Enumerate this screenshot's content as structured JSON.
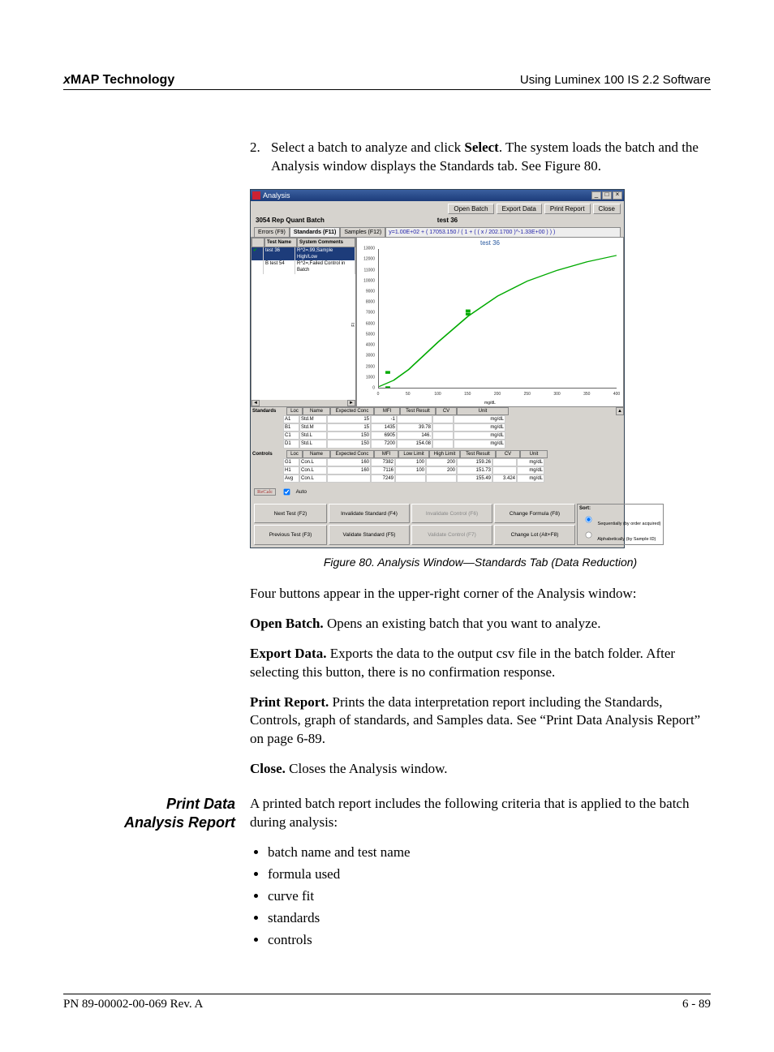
{
  "header": {
    "brand_x": "x",
    "brand_rest": "MAP Technology",
    "right": "Using Luminex 100 IS 2.2 Software"
  },
  "step2": {
    "num": "2.",
    "text_before_bold": "Select a batch to analyze and click ",
    "bold": "Select",
    "text_after": ". The system loads the batch and the Analysis window displays the Standards tab. See Figure 80."
  },
  "figure_caption": "Figure 80.  Analysis Window—Standards Tab (Data Reduction)",
  "intro_para": "Four buttons appear in the upper-right corner of the Analysis window:",
  "btns_desc": {
    "open_batch": {
      "title": "Open Batch.",
      "text": " Opens an existing batch that you want to analyze."
    },
    "export_data": {
      "title": "Export Data.",
      "text": " Exports the data to the output csv file in the batch folder. After selecting this button, there is no confirmation response."
    },
    "print_report": {
      "title": "Print Report.",
      "text": " Prints the data interpretation report including the Standards, Controls, graph of standards, and Samples data. See “Print Data Analysis Report” on page 6-89."
    },
    "close": {
      "title": "Close.",
      "text": " Closes the Analysis window."
    }
  },
  "section_heading": {
    "l1": "Print Data",
    "l2": "Analysis Report"
  },
  "section_intro": "A printed batch report includes the following criteria that is applied to the batch during analysis:",
  "bullets": [
    "batch name and test name",
    "formula used",
    "curve fit",
    "standards",
    "controls"
  ],
  "footer": {
    "left": "PN 89-00002-00-069 Rev. A",
    "right": "6 - 89"
  },
  "app": {
    "title": "Analysis",
    "win_buttons": {
      "min": "_",
      "max": "□",
      "close": "×"
    },
    "top_buttons": {
      "open": "Open Batch",
      "export": "Export Data",
      "print": "Print Report",
      "close": "Close"
    },
    "batch_name": "3054 Rep Quant Batch",
    "test_name": "test 36",
    "tabs": {
      "errors": "Errors (F9)",
      "standards": "Standards (F11)",
      "samples": "Samples (F12)"
    },
    "formula": "y=1.00E+02 + ( 17053.150 / ( 1 + ( ( x / 202.1700 )^-1.33E+00 ) ) )",
    "left_headers": {
      "name": "Test Name",
      "comments": "System Comments"
    },
    "left_rows": [
      {
        "chk": "✔",
        "name": "test 36",
        "comment": "R^2=.99,Sample High/Low"
      },
      {
        "chk": "",
        "name": "B test 54",
        "comment": "R^2=,Failed Control in Batch"
      }
    ],
    "chart_title": "test 36",
    "chart_xlabel": "mg/dL",
    "chart_ylabel": "FI",
    "chart_xticks": [
      "0",
      "50",
      "100",
      "150",
      "200",
      "250",
      "300",
      "350",
      "400"
    ],
    "chart_yticks": [
      "0",
      "1000",
      "2000",
      "3000",
      "4000",
      "5000",
      "6000",
      "7000",
      "8000",
      "9000",
      "10000",
      "11000",
      "12000",
      "13000"
    ],
    "std_label": "Standards",
    "std_headers": [
      "Loc",
      "Name",
      "Expected Conc",
      "MFI",
      "Test Result",
      "CV",
      "Unit"
    ],
    "std_rows": [
      [
        "A1",
        "Std.M",
        "15",
        "-1",
        "",
        "",
        "mg/dL"
      ],
      [
        "B1",
        "Std.M",
        "15",
        "1435",
        "39.78",
        "",
        "mg/dL"
      ],
      [
        "C1",
        "Std.L",
        "150",
        "6905",
        "146.",
        "",
        "mg/dL"
      ],
      [
        "D1",
        "Std.L",
        "150",
        "7200",
        "154.08",
        "",
        "mg/dL"
      ]
    ],
    "ctl_label": "Controls",
    "ctl_headers": [
      "Loc",
      "Name",
      "Expected Conc",
      "MFI",
      "Low Limit",
      "High Limit",
      "Test Result",
      "CV",
      "Unit"
    ],
    "ctl_rows": [
      [
        "G1",
        "Con.L",
        "160",
        "7382",
        "100",
        "200",
        "159.26",
        "",
        "mg/dL"
      ],
      [
        "H1",
        "Con.L",
        "160",
        "7116",
        "100",
        "200",
        "151.73",
        "",
        "mg/dL"
      ],
      [
        "Avg",
        "Con.L",
        "",
        "7249",
        "",
        "",
        "155.49",
        "3.424",
        "mg/dL"
      ]
    ],
    "recalc": "ReCalc",
    "auto": "Auto",
    "bottom_buttons": {
      "next": "Next Test (F2)",
      "prev": "Previous Test (F3)",
      "inv_std": "Invalidate Standard (F4)",
      "val_std": "Validate Standard (F5)",
      "inv_ctl": "Invalidate Control (F6)",
      "val_ctl": "Validate Control (F7)",
      "chg_formula": "Change Formula (F8)",
      "chg_lot": "Change Lot (Alt+F8)"
    },
    "sort": {
      "title": "Sort:",
      "opt1": "Sequentially (by order acquired)",
      "opt2": "Alphabetically (by Sample ID)"
    }
  },
  "chart_data": {
    "type": "line",
    "title": "test 36",
    "xlabel": "mg/dL",
    "ylabel": "FI",
    "xlim": [
      0,
      400
    ],
    "ylim": [
      0,
      13000
    ],
    "series": [
      {
        "name": "fit",
        "x": [
          0,
          25,
          50,
          75,
          100,
          150,
          200,
          250,
          300,
          350,
          400
        ],
        "y": [
          100,
          700,
          1700,
          3000,
          4300,
          6700,
          8600,
          10000,
          11000,
          11800,
          12400
        ]
      },
      {
        "name": "standards",
        "type": "scatter",
        "x": [
          15,
          15,
          150,
          150
        ],
        "y": [
          0,
          1435,
          6905,
          7200
        ]
      }
    ]
  }
}
